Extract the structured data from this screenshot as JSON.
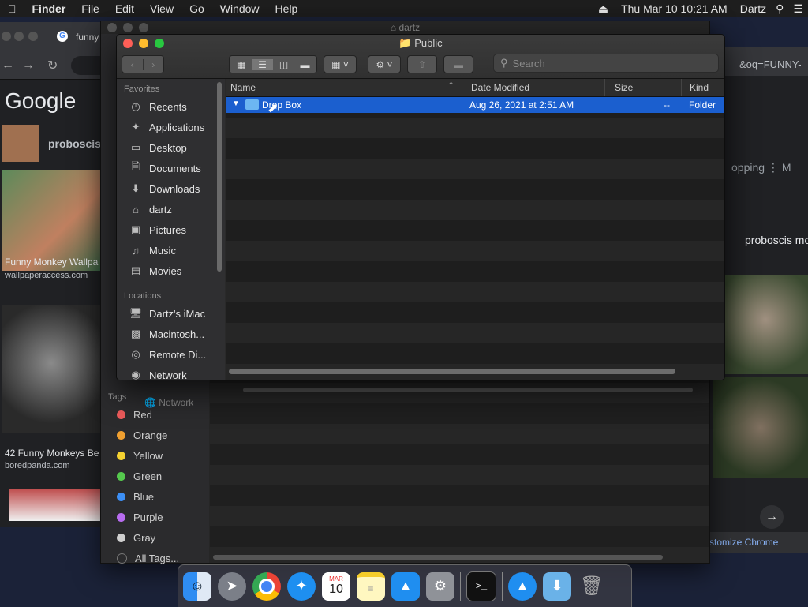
{
  "menubar": {
    "app": "Finder",
    "items": [
      "File",
      "Edit",
      "View",
      "Go",
      "Window",
      "Help"
    ],
    "clock": "Thu Mar 10  10:21 AM",
    "user": "Dartz"
  },
  "chrome": {
    "tab_title": "funny",
    "url_fragment": "&oq=FUNNY-",
    "logo": "Google",
    "related_search": "proboscis",
    "shopping": "opping",
    "more": "M",
    "right_heading": "proboscis mo",
    "results": [
      {
        "title": "Funny Monkey Wallpa",
        "source": "wallpaperaccess.com"
      },
      {
        "title": "42 Funny Monkeys Be",
        "source": "boredpanda.com"
      }
    ],
    "customize": "stomize Chrome"
  },
  "finder_back": {
    "title": "dartz",
    "network": "Network",
    "tags_heading": "Tags",
    "tags": [
      {
        "label": "Red",
        "color": "#ec5b5b"
      },
      {
        "label": "Orange",
        "color": "#f0a030"
      },
      {
        "label": "Yellow",
        "color": "#f5d231"
      },
      {
        "label": "Green",
        "color": "#55c94d"
      },
      {
        "label": "Blue",
        "color": "#3c8ff5"
      },
      {
        "label": "Purple",
        "color": "#b86cf0"
      },
      {
        "label": "Gray",
        "color": "#9a9a9a"
      },
      {
        "label": "All Tags...",
        "color": "#555555"
      }
    ]
  },
  "finder": {
    "title": "Public",
    "search_placeholder": "Search",
    "favorites_heading": "Favorites",
    "favorites": [
      {
        "label": "Recents",
        "icon": "clock-icon"
      },
      {
        "label": "Applications",
        "icon": "applications-icon"
      },
      {
        "label": "Desktop",
        "icon": "desktop-icon"
      },
      {
        "label": "Documents",
        "icon": "document-icon"
      },
      {
        "label": "Downloads",
        "icon": "download-icon"
      },
      {
        "label": "dartz",
        "icon": "home-icon"
      },
      {
        "label": "Pictures",
        "icon": "camera-icon"
      },
      {
        "label": "Music",
        "icon": "music-icon"
      },
      {
        "label": "Movies",
        "icon": "film-icon"
      }
    ],
    "locations_heading": "Locations",
    "locations": [
      {
        "label": "Dartz's iMac",
        "icon": "computer-icon"
      },
      {
        "label": "Macintosh...",
        "icon": "disk-icon"
      },
      {
        "label": "Remote Di...",
        "icon": "remote-disc-icon"
      },
      {
        "label": "Network",
        "icon": "globe-icon"
      }
    ],
    "columns": {
      "name": "Name",
      "date": "Date Modified",
      "size": "Size",
      "kind": "Kind"
    },
    "rows": [
      {
        "name": "Drop Box",
        "date": "Aug 26, 2021 at 2:51 AM",
        "size": "--",
        "kind": "Folder"
      }
    ]
  },
  "dock": {
    "items": [
      "finder-icon",
      "launchpad-icon",
      "chrome-icon",
      "safari-icon",
      "calendar-icon",
      "notes-icon",
      "app-store-icon",
      "system-preferences-icon",
      "terminal-icon",
      "app-store-download-icon",
      "downloads-folder-icon",
      "trash-icon"
    ],
    "calendar_month": "MAR",
    "calendar_day": "10"
  }
}
